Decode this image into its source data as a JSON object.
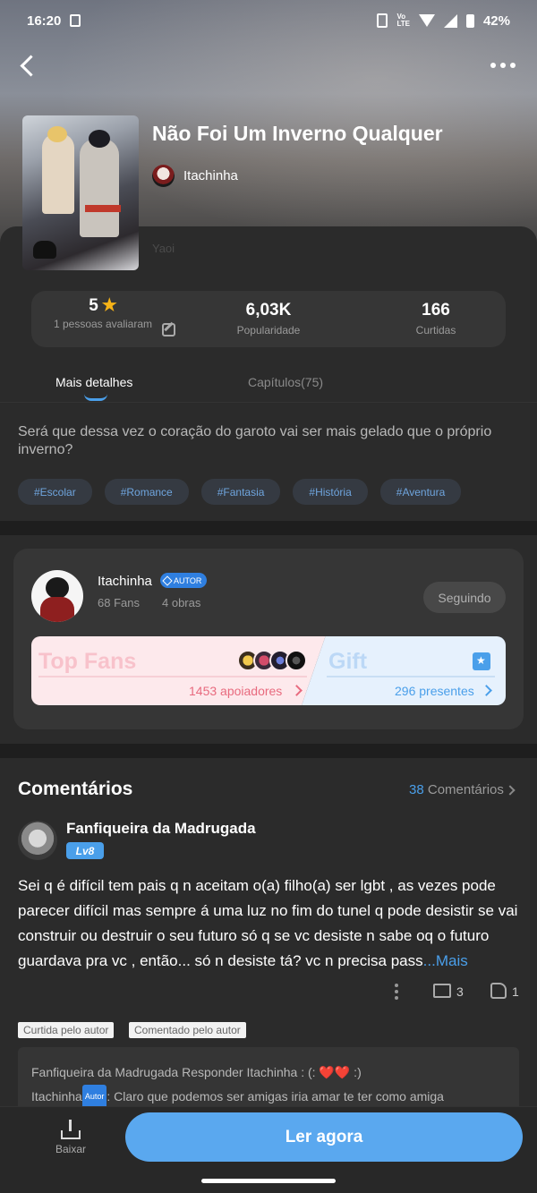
{
  "status_bar": {
    "time": "16:20",
    "volte": "Vo\nLTE",
    "battery": "42%"
  },
  "book": {
    "title": "Não Foi Um Inverno Qualquer",
    "author": "Itachinha",
    "genre": "Yaoi",
    "synopsis": "Será que dessa vez o coração do garoto vai ser mais gelado que o próprio inverno?",
    "tags": [
      "#Escolar",
      "#Romance",
      "#Fantasia",
      "#História",
      "#Aventura"
    ]
  },
  "stats": {
    "rating": "5",
    "rating_label": "1 pessoas avaliaram",
    "popularity": "6,03K",
    "popularity_label": "Popularidade",
    "likes": "166",
    "likes_label": "Curtidas"
  },
  "tabs": {
    "details": "Mais detalhes",
    "chapters": "Capítulos(75)"
  },
  "author_card": {
    "name": "Itachinha",
    "badge": "AUTOR",
    "fans": "68 Fans",
    "works": "4 obras",
    "follow": "Seguindo",
    "top_fans_title": "Top Fans",
    "supporters": "1453 apoiadores",
    "gift_title": "Gift",
    "presents": "296 presentes"
  },
  "comments": {
    "heading": "Comentários",
    "count": "38",
    "count_label": "Comentários",
    "item": {
      "user": "Fanfiqueira da Madrugada",
      "level": "Lv8",
      "text": "Sei q é difícil tem pais q n aceitam o(a) filho(a) ser lgbt , as vezes pode parecer difícil mas sempre á uma luz no fim do tunel q pode desistir se vai construir ou destruir o seu futuro  só q se vc desiste n sabe oq o futuro guardava pra vc , então... só n desiste tá? vc n precisa pass",
      "more": "...Mais",
      "reply_count": "3",
      "like_count": "1",
      "tag_liked": "Curtida pelo autor",
      "tag_commented": "Comentado pelo autor",
      "reply1_prefix": "Fanfiqueira da Madrugada Responder Itachinha : (: ",
      "reply1_hearts": "❤️❤️",
      "reply1_suffix": " :)",
      "reply2_user": "Itachinha",
      "reply2_badge": "Autor",
      "reply2_text": ": Claro que podemos ser amigas iria amar te ter como amiga"
    }
  },
  "bottom": {
    "download": "Baixar",
    "read_now": "Ler agora"
  },
  "colors": {
    "accent": "#4a9fea",
    "star": "#f6b317",
    "pink": "#e86a7e"
  }
}
